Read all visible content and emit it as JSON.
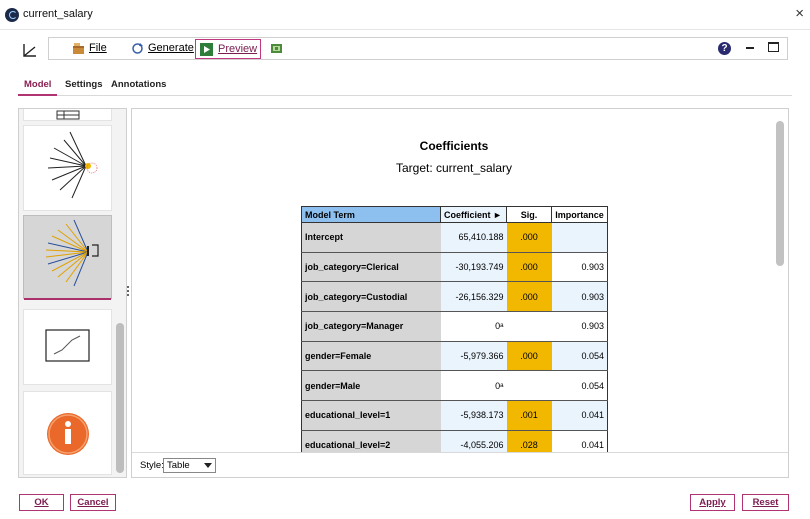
{
  "window": {
    "title": "current_salary",
    "close_glyph": "×"
  },
  "toolbar": {
    "file_label": "File",
    "generate_label": "Generate",
    "preview_label": "Preview",
    "help_glyph": "?"
  },
  "tabs": [
    {
      "label": "Model",
      "active": true
    },
    {
      "label": "Settings",
      "active": false
    },
    {
      "label": "Annotations",
      "active": false
    }
  ],
  "thumbnails": [
    {
      "icon": "table-icon"
    },
    {
      "icon": "network-diagram-icon"
    },
    {
      "icon": "coefficient-diagram-icon",
      "selected": true
    },
    {
      "icon": "line-chart-icon"
    },
    {
      "icon": "info-icon"
    }
  ],
  "coefficients": {
    "title": "Coefficients",
    "target": "Target: current_salary",
    "headers": {
      "term": "Model Term",
      "coefficient": "Coefficient ►",
      "sig": "Sig.",
      "importance": "Importance"
    },
    "rows": [
      {
        "term": "Intercept",
        "coefficient": "65,410.188",
        "sig": ".000",
        "importance": ""
      },
      {
        "term": "job_category=Clerical",
        "coefficient": "-30,193.749",
        "sig": ".000",
        "importance": "0.903"
      },
      {
        "term": "job_category=Custodial",
        "coefficient": "-26,156.329",
        "sig": ".000",
        "importance": "0.903"
      },
      {
        "term": "job_category=Manager",
        "coefficient": "0ᵃ",
        "sig": "",
        "importance": "0.903"
      },
      {
        "term": "gender=Female",
        "coefficient": "-5,979.366",
        "sig": ".000",
        "importance": "0.054"
      },
      {
        "term": "gender=Male",
        "coefficient": "0ᵃ",
        "sig": "",
        "importance": "0.054"
      },
      {
        "term": "educational_level=1",
        "coefficient": "-5,938.173",
        "sig": ".001",
        "importance": "0.041"
      },
      {
        "term": "educational_level=2",
        "coefficient": "-4,055.206",
        "sig": ".028",
        "importance": "0.041"
      }
    ]
  },
  "style_bar": {
    "label": "Style:",
    "selected": "Table"
  },
  "buttons": {
    "ok": "OK",
    "cancel": "Cancel",
    "apply": "Apply",
    "reset": "Reset"
  },
  "colors": {
    "accent": "#b03471",
    "sig_highlight": "#f2b800",
    "header_blue": "#8ec0ef",
    "cell_blue": "#eaf4fd",
    "term_gray": "#d6d6d6"
  }
}
